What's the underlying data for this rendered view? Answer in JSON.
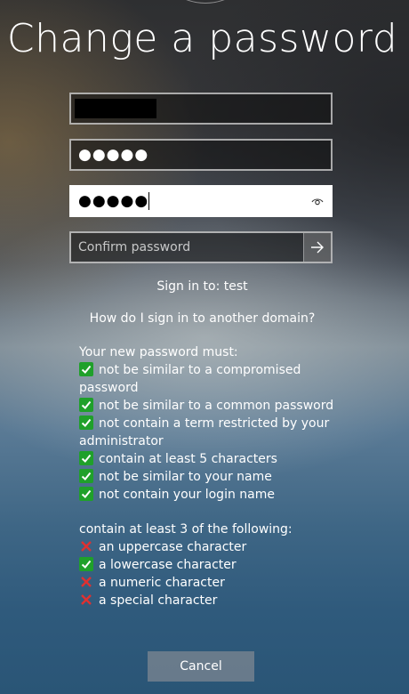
{
  "title": "Change a password",
  "fields": {
    "old_password_dots": "●●●●●",
    "new_password_dots": "●●●●●",
    "confirm_placeholder": "Confirm password"
  },
  "sign_in_to": "Sign in to: test",
  "other_domain_link": "How do I sign in to another domain?",
  "requirements": {
    "heading": "Your new password must:",
    "items": [
      {
        "status": "pass",
        "text": "not be similar to a compromised password"
      },
      {
        "status": "pass",
        "text": "not be similar to a common password"
      },
      {
        "status": "pass",
        "text": "not contain a term restricted by your administrator"
      },
      {
        "status": "pass",
        "text": "contain at least 5 characters"
      },
      {
        "status": "pass",
        "text": "not be similar to your name"
      },
      {
        "status": "pass",
        "text": "not contain your login name"
      }
    ]
  },
  "categories": {
    "heading": "contain at least 3 of the following:",
    "items": [
      {
        "status": "fail",
        "text": "an uppercase character"
      },
      {
        "status": "pass",
        "text": "a lowercase character"
      },
      {
        "status": "fail",
        "text": "a numeric character"
      },
      {
        "status": "fail",
        "text": "a special character"
      }
    ]
  },
  "cancel_label": "Cancel",
  "icons": {
    "reveal": "eye-icon",
    "submit": "arrow-right-icon",
    "pass": "check-icon",
    "fail": "cross-icon"
  },
  "colors": {
    "pass": "#1fa02a",
    "fail": "#e03030"
  }
}
